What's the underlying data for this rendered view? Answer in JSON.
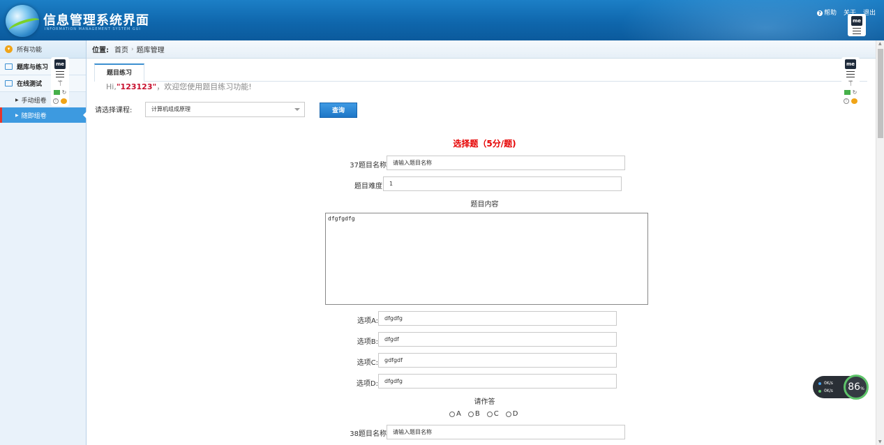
{
  "header": {
    "title": "信息管理系统界面",
    "subtitle": "INFORMATION MANAGEMENT SYSTEM GUI",
    "links": [
      "帮助",
      "关于",
      "退出"
    ]
  },
  "sidebar": {
    "all_label": "所有功能",
    "groups": [
      {
        "label": "题库与练习"
      },
      {
        "label": "在线测试",
        "items": [
          "手动组卷",
          "随即组卷"
        ]
      }
    ]
  },
  "widget": {
    "badge": "me"
  },
  "breadcrumb": {
    "prefix": "位置:",
    "items": [
      "首页",
      "题库管理"
    ]
  },
  "tabs": [
    "题目练习"
  ],
  "greeting": {
    "prefix": "Hi,",
    "name": "\"123123\"",
    "suffix": "，欢迎您使用题目练习功能!"
  },
  "course": {
    "label": "请选择课程:",
    "selected": "计算机组成原理",
    "query_button": "查询"
  },
  "section_title": "选择题（5分/题)",
  "question": {
    "name_label": "37题目名称",
    "name_placeholder": "请输入题目名称",
    "difficulty_label": "题目难度",
    "difficulty_value": "1",
    "content_label": "题目内容",
    "content_value": "dfgfgdfg",
    "options": [
      {
        "label": "选项A:",
        "value": "dfgdfg"
      },
      {
        "label": "选项B:",
        "value": "dfgdf"
      },
      {
        "label": "选项C:",
        "value": "gdfgdf"
      },
      {
        "label": "选项D:",
        "value": "dfgdfg"
      }
    ],
    "answer_label": "请作答",
    "answer_choices": [
      "A",
      "B",
      "C",
      "D"
    ]
  },
  "next_question": {
    "name_label": "38题目名称",
    "name_placeholder": "请输入题目名称"
  },
  "net_speed": {
    "up": "0K/s",
    "down": "0K/s",
    "percent": "86",
    "unit": "%"
  }
}
